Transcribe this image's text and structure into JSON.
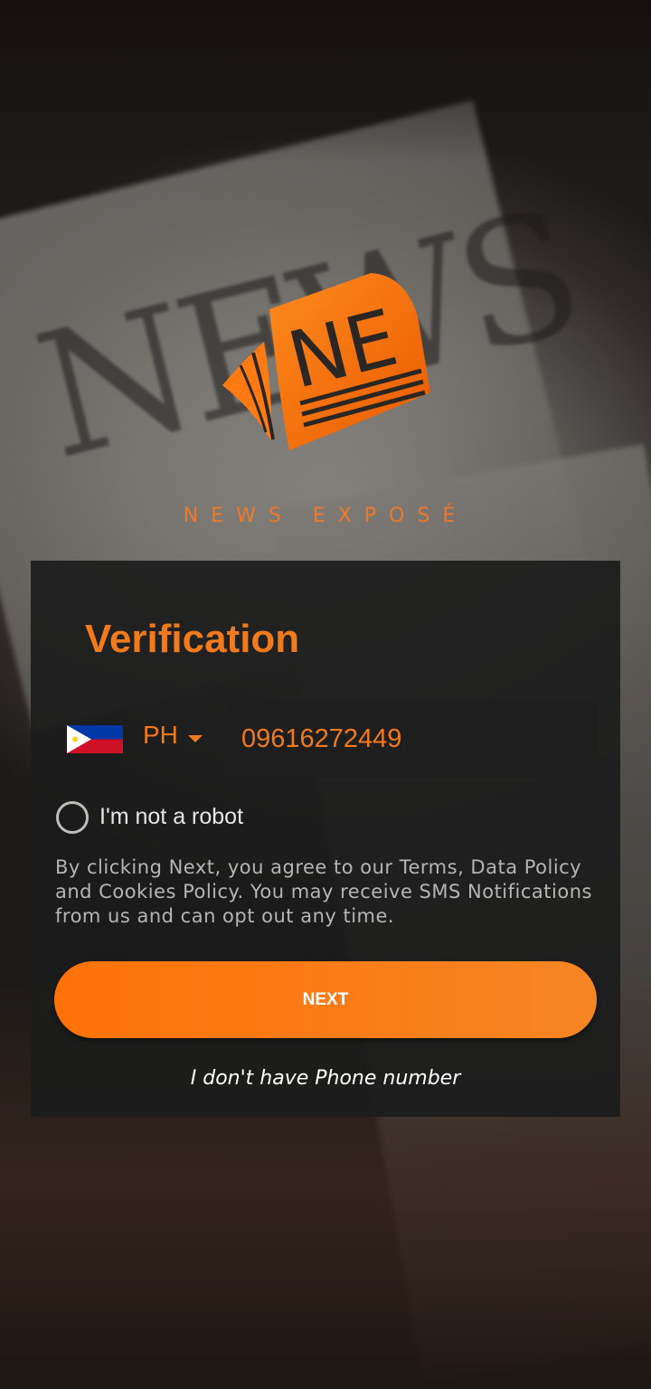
{
  "brand": {
    "name": "NEWS EXPOSÉ",
    "logo_letters": "NE",
    "accent_color": "#f17a1c"
  },
  "verification": {
    "title": "Verification",
    "country_code": "PH",
    "country_flag": "philippines-flag",
    "phone_value": "09616272449",
    "captcha_label": "I'm not a robot",
    "terms_text": "By clicking Next, you agree to our Terms, Data Policy and Cookies Policy. You may receive SMS Notifications from us and can opt out any time.",
    "next_label": "NEXT",
    "no_phone_link": "I don't have Phone number"
  }
}
